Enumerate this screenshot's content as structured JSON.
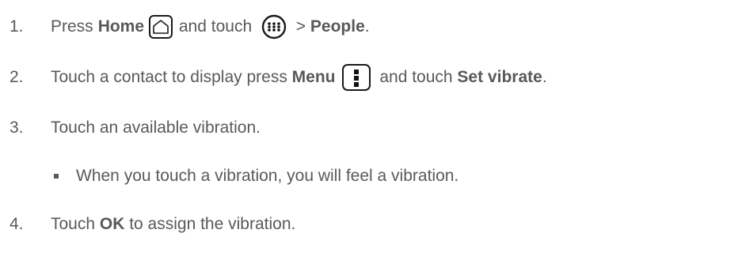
{
  "steps": [
    {
      "number": "1.",
      "parts": [
        "Press ",
        "Home",
        " and touch ",
        " > ",
        "People",
        "."
      ]
    },
    {
      "number": "2.",
      "parts": [
        "Touch a contact to display press ",
        "Menu",
        " and touch ",
        "Set vibrate",
        "."
      ]
    },
    {
      "number": "3.",
      "text": "Touch an available vibration."
    },
    {
      "bullet": "When you touch a vibration, you will feel a vibration."
    },
    {
      "number": "4.",
      "parts": [
        "Touch ",
        "OK",
        " to assign the vibration."
      ]
    }
  ],
  "icons": {
    "home": "home-key-icon",
    "apps": "apps-icon",
    "menu": "menu-key-icon"
  }
}
